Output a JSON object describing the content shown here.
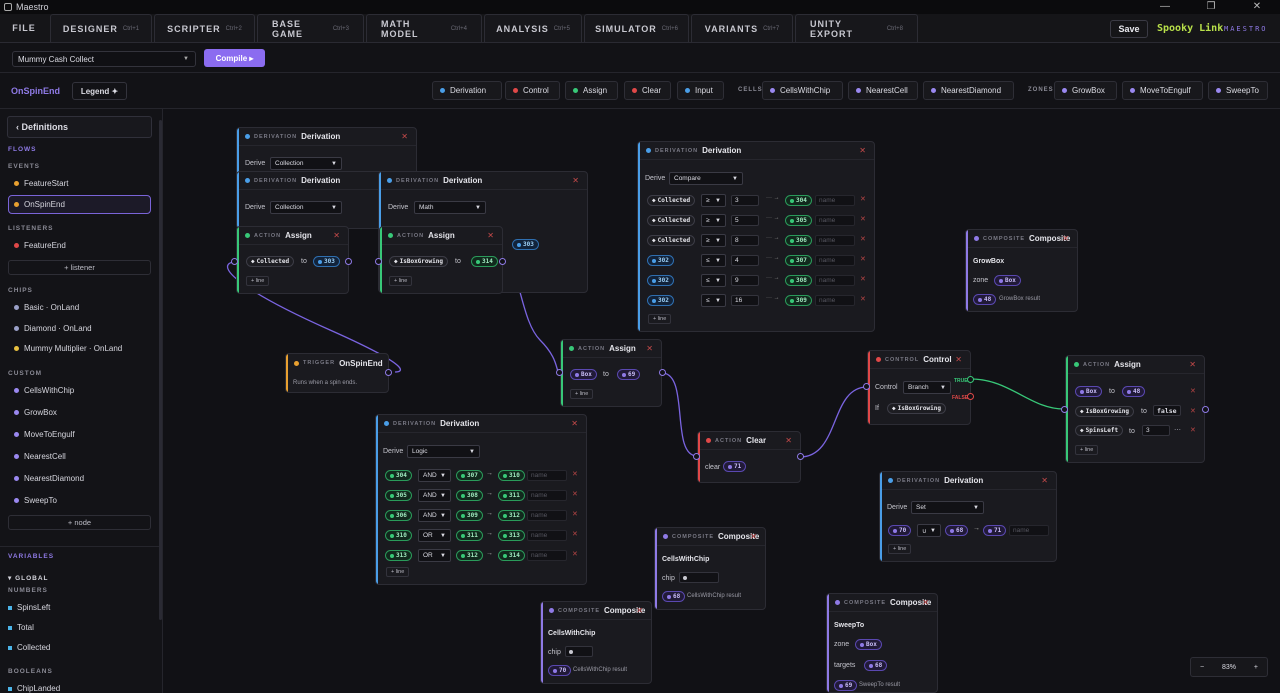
{
  "window": {
    "title": "Maestro",
    "min": "—",
    "max": "❐",
    "close": "✕"
  },
  "tabs": [
    {
      "label": "FILE",
      "shortcut": ""
    },
    {
      "label": "DESIGNER",
      "shortcut": "Ctrl+1"
    },
    {
      "label": "SCRIPTER",
      "shortcut": "Ctrl+2"
    },
    {
      "label": "BASE GAME",
      "shortcut": "Ctrl+3"
    },
    {
      "label": "MATH MODEL",
      "shortcut": "Ctrl+4"
    },
    {
      "label": "ANALYSIS",
      "shortcut": "Ctrl+5"
    },
    {
      "label": "SIMULATOR",
      "shortcut": "Ctrl+6"
    },
    {
      "label": "VARIANTS",
      "shortcut": "Ctrl+7"
    },
    {
      "label": "UNITY EXPORT",
      "shortcut": "Ctrl+8"
    }
  ],
  "toolbar": {
    "save": "Save",
    "project": "Spooky Link",
    "brand": "MAESTRO",
    "game_select": "Mummy Cash Collect",
    "compile": "Compile ▸"
  },
  "flowbar": {
    "title": "OnSpinEnd",
    "legend": "Legend ✦",
    "kinds": [
      {
        "label": "Derivation",
        "color": "#4a9ee8"
      },
      {
        "label": "Control",
        "color": "#e04848"
      },
      {
        "label": "Assign",
        "color": "#38c878"
      },
      {
        "label": "Clear",
        "color": "#e04848"
      },
      {
        "label": "Input",
        "color": "#4a9ee8"
      }
    ],
    "cells_label": "CELLS",
    "cells": [
      "CellsWithChip",
      "NearestCell",
      "NearestDiamond"
    ],
    "zones_label": "ZONES",
    "zones": [
      "GrowBox",
      "MoveToEngulf",
      "SweepTo"
    ]
  },
  "sidebar": {
    "definitions": "‹ Definitions",
    "flows": "FLOWS",
    "events": "EVENTS",
    "event_items": [
      "FeatureStart",
      "OnSpinEnd"
    ],
    "listeners": "LISTENERS",
    "listener_items": [
      "FeatureEnd"
    ],
    "add_listener": "+ listener",
    "chips": "CHIPS",
    "chip_items": [
      {
        "label": "Basic · OnLand",
        "color": "#9aa0c8"
      },
      {
        "label": "Diamond · OnLand",
        "color": "#9aa0c8"
      },
      {
        "label": "Mummy Multiplier · OnLand",
        "color": "#e8c040"
      }
    ],
    "custom": "CUSTOM",
    "custom_items": [
      "CellsWithChip",
      "GrowBox",
      "MoveToEngulf",
      "NearestCell",
      "NearestDiamond",
      "SweepTo"
    ],
    "add_node": "+ node",
    "variables": "VARIABLES",
    "global": "▾ GLOBAL",
    "numbers": "NUMBERS",
    "number_items": [
      "SpinsLeft",
      "Total",
      "Collected"
    ],
    "booleans": "BOOLEANS",
    "boolean_items": [
      "ChipLanded"
    ]
  },
  "nodes": {
    "d1": {
      "kind": "DERIVATION",
      "title": "Derivation",
      "derive": "Derive",
      "value": "Collection"
    },
    "d2": {
      "kind": "DERIVATION",
      "title": "Derivation",
      "derive": "Derive",
      "value": "Collection"
    },
    "d3": {
      "kind": "DERIVATION",
      "title": "Derivation",
      "derive": "Derive",
      "value": "Math"
    },
    "a1": {
      "kind": "ACTION",
      "title": "Assign",
      "var": "Collected",
      "to": "to",
      "ref": "303",
      "add": "+ line"
    },
    "a2": {
      "kind": "ACTION",
      "title": "Assign",
      "var": "IsBoxGrowing",
      "to": "to",
      "ref": "314",
      "add": "+ line",
      "behind": "303"
    },
    "trig": {
      "kind": "TRIGGER",
      "title": "OnSpinEnd",
      "desc": "Runs when a spin ends."
    },
    "cmp": {
      "kind": "DERIVATION",
      "title": "Derivation",
      "derive": "Derive",
      "value": "Compare",
      "name_ph": "name",
      "add": "+ line",
      "rows": [
        {
          "a": "Collected",
          "op": "≥",
          "v": "3",
          "out": "304"
        },
        {
          "a": "Collected",
          "op": "≥",
          "v": "5",
          "out": "305"
        },
        {
          "a": "Collected",
          "op": "≥",
          "v": "8",
          "out": "306"
        },
        {
          "a": "302",
          "op": "≤",
          "v": "4",
          "out": "307"
        },
        {
          "a": "302",
          "op": "≤",
          "v": "9",
          "out": "308"
        },
        {
          "a": "302",
          "op": "≤",
          "v": "16",
          "out": "309"
        }
      ]
    },
    "cgrow": {
      "kind": "COMPOSITE",
      "title": "Composite",
      "name": "GrowBox",
      "zone": "zone",
      "zone_v": "Box",
      "out": "48",
      "out_label": "GrowBox result"
    },
    "a3": {
      "kind": "ACTION",
      "title": "Assign",
      "var": "Box",
      "to": "to",
      "ref": "69",
      "add": "+ line"
    },
    "logic": {
      "kind": "DERIVATION",
      "title": "Derivation",
      "derive": "Derive",
      "value": "Logic",
      "name_ph": "name",
      "add": "+ line",
      "rows": [
        {
          "a": "304",
          "op": "AND",
          "b": "307",
          "out": "310"
        },
        {
          "a": "305",
          "op": "AND",
          "b": "308",
          "out": "311"
        },
        {
          "a": "306",
          "op": "AND",
          "b": "309",
          "out": "312"
        },
        {
          "a": "310",
          "op": "OR",
          "b": "311",
          "out": "313"
        },
        {
          "a": "313",
          "op": "OR",
          "b": "312",
          "out": "314"
        }
      ]
    },
    "clear": {
      "kind": "ACTION",
      "title": "Clear",
      "label": "clear",
      "ref": "71"
    },
    "ctrl": {
      "kind": "CONTROL",
      "title": "Control",
      "label": "Control",
      "value": "Branch",
      "if": "If",
      "cond": "IsBoxGrowing",
      "true": "TRUE",
      "false": "FALSE"
    },
    "a4": {
      "kind": "ACTION",
      "title": "Assign",
      "add": "+ line",
      "rows": [
        {
          "v": "Box",
          "to": "to",
          "r": "48"
        },
        {
          "v": "IsBoxGrowing",
          "to": "to",
          "r": "false"
        },
        {
          "v": "SpinsLeft",
          "to": "to",
          "r": "3"
        }
      ]
    },
    "dset": {
      "kind": "DERIVATION",
      "title": "Derivation",
      "derive": "Derive",
      "value": "Set",
      "a": "70",
      "op": "∪",
      "b": "68",
      "out": "71",
      "name_ph": "name",
      "add": "+ line"
    },
    "ccell1": {
      "kind": "COMPOSITE",
      "title": "Composite",
      "name": "CellsWithChip",
      "chip": "chip",
      "out": "68",
      "out_label": "CellsWithChip result"
    },
    "ccell2": {
      "kind": "COMPOSITE",
      "title": "Composite",
      "name": "CellsWithChip",
      "chip": "chip",
      "out": "70",
      "out_label": "CellsWithChip result"
    },
    "csweep": {
      "kind": "COMPOSITE",
      "title": "Composite",
      "name": "SweepTo",
      "zone": "zone",
      "zone_v": "Box",
      "targets": "targets",
      "targets_v": "68",
      "out": "69",
      "out_label": "SweepTo result"
    }
  },
  "zoom": {
    "minus": "−",
    "level": "83%",
    "plus": "+"
  },
  "colors": {
    "accent": "#8b6cf0",
    "derivation": "#4a9ee8",
    "action": "#38c878",
    "control": "#e04848",
    "trigger": "#e8a030",
    "composite": "#8f7ae6"
  }
}
